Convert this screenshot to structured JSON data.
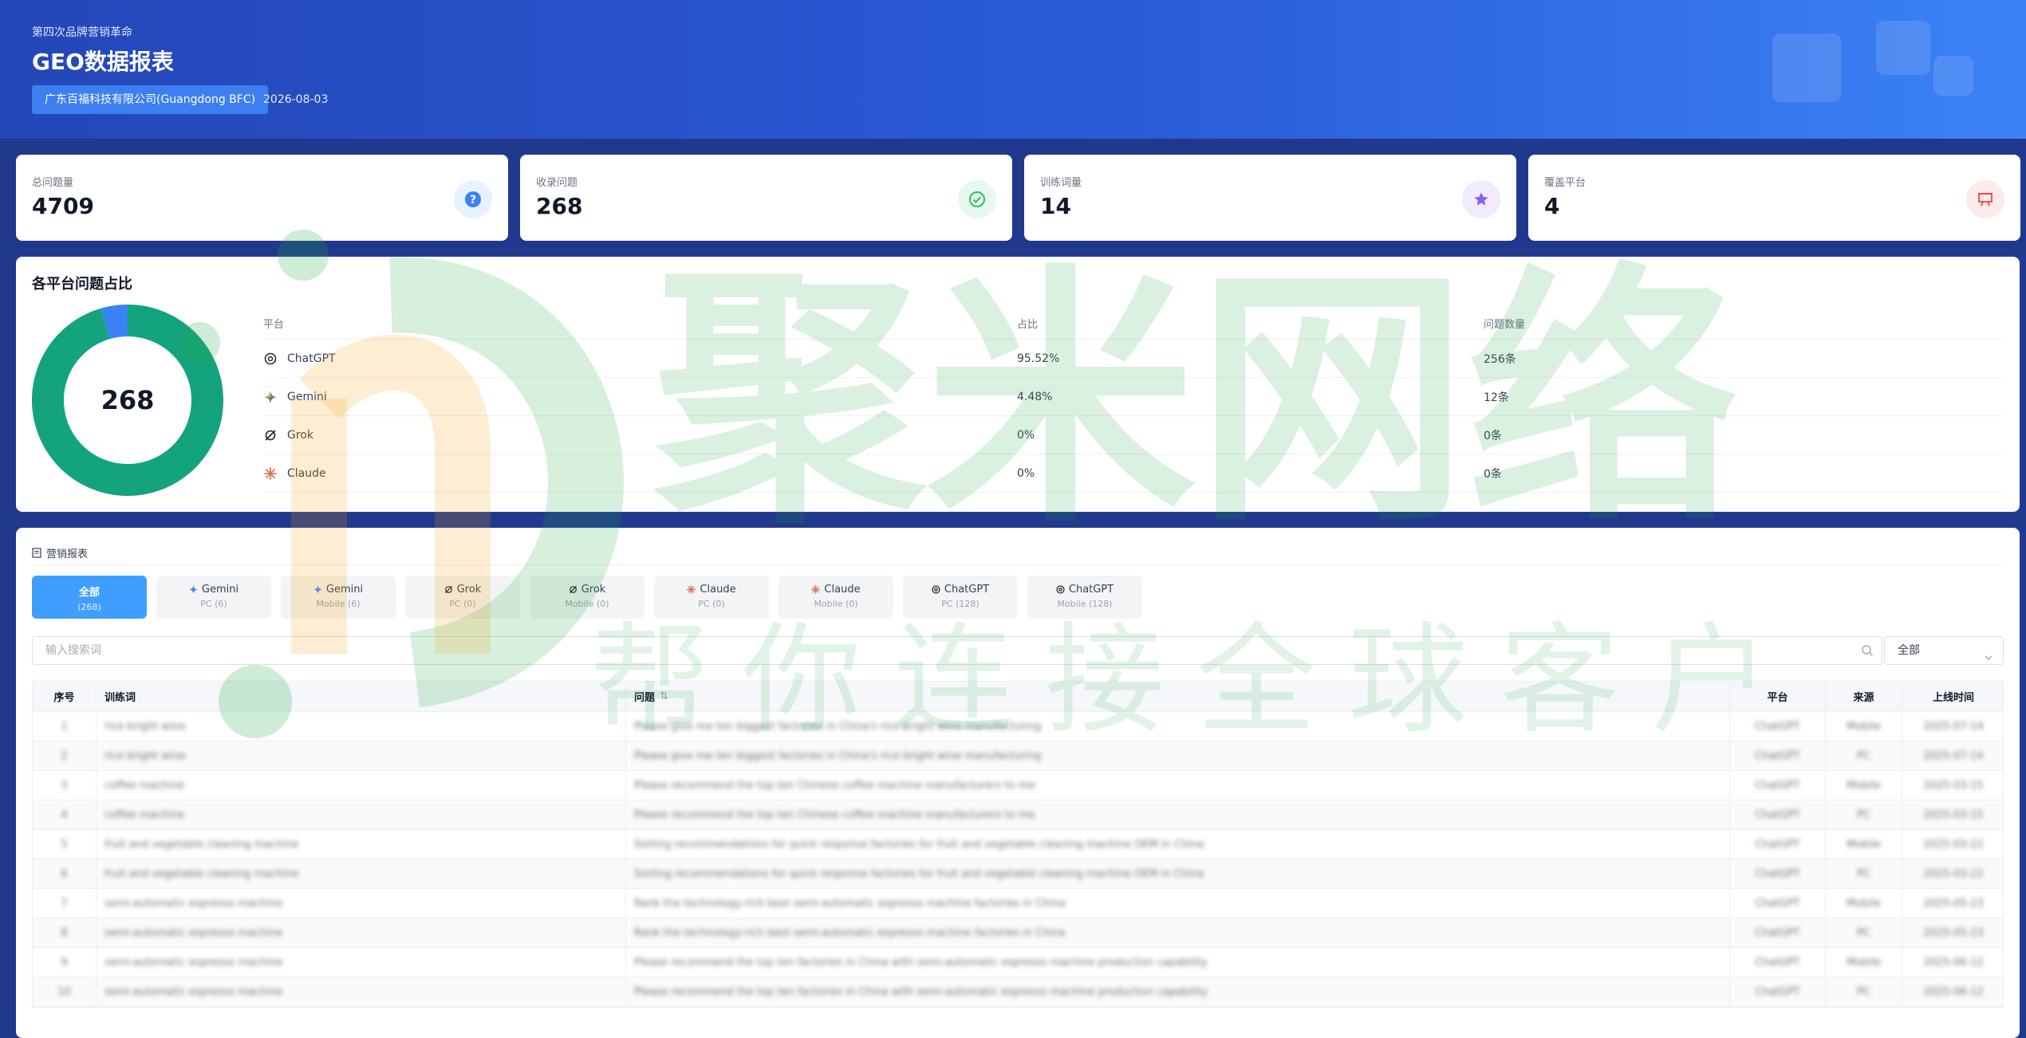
{
  "header": {
    "kicker": "第四次品牌营销革命",
    "title": "GEO数据报表",
    "company": "广东百福科技有限公司(Guangdong BFC)",
    "date": "2026-08-03"
  },
  "stats": [
    {
      "label": "总问题量",
      "value": "4709",
      "icon": "question-icon",
      "color": "#3b82f6"
    },
    {
      "label": "收录问题",
      "value": "268",
      "icon": "check-circle-icon",
      "color": "#22c55e"
    },
    {
      "label": "训练词量",
      "value": "14",
      "icon": "star-icon",
      "color": "#8b5cf6"
    },
    {
      "label": "覆盖平台",
      "value": "4",
      "icon": "presentation-icon",
      "color": "#ef4444"
    }
  ],
  "share": {
    "title": "各平台问题占比",
    "total": "268",
    "headers": {
      "platform": "平台",
      "pct": "占比",
      "count": "问题数量"
    },
    "rows": [
      {
        "platform": "ChatGPT",
        "pct": "95.52%",
        "count": "256条",
        "icon": "chatgpt-icon"
      },
      {
        "platform": "Gemini",
        "pct": "4.48%",
        "count": "12条",
        "icon": "gemini-icon"
      },
      {
        "platform": "Grok",
        "pct": "0%",
        "count": "0条",
        "icon": "grok-icon"
      },
      {
        "platform": "Claude",
        "pct": "0%",
        "count": "0条",
        "icon": "claude-icon"
      }
    ],
    "donut": {
      "values": [
        256,
        12
      ],
      "colors": [
        "#14a37f",
        "#3b82f6"
      ]
    }
  },
  "report": {
    "title": "营销报表",
    "tabs": [
      {
        "name": "全部",
        "sub": "(268)",
        "icon": "",
        "active": true
      },
      {
        "name": "Gemini",
        "sub": "PC (6)",
        "icon": "gemini-icon"
      },
      {
        "name": "Gemini",
        "sub": "Mobile (6)",
        "icon": "gemini-icon"
      },
      {
        "name": "Grok",
        "sub": "PC (0)",
        "icon": "grok-icon"
      },
      {
        "name": "Grok",
        "sub": "Mobile (0)",
        "icon": "grok-icon"
      },
      {
        "name": "Claude",
        "sub": "PC (0)",
        "icon": "claude-icon"
      },
      {
        "name": "Claude",
        "sub": "Mobile (0)",
        "icon": "claude-icon"
      },
      {
        "name": "ChatGPT",
        "sub": "PC (128)",
        "icon": "chatgpt-icon"
      },
      {
        "name": "ChatGPT",
        "sub": "Mobile (128)",
        "icon": "chatgpt-icon"
      }
    ],
    "search_placeholder": "输入搜索词",
    "filter_value": "全部",
    "columns": {
      "seq": "序号",
      "kw": "训练词",
      "q": "问题",
      "plat": "平台",
      "src": "来源",
      "time": "上线时间"
    },
    "rows": [
      {
        "seq": "1",
        "kw": "rice bright wine",
        "q": "Please give me ten biggest factories in China's rice bright wine manufacturing",
        "plat": "ChatGPT",
        "src": "Mobile",
        "time": "2025-07-14"
      },
      {
        "seq": "2",
        "kw": "rice bright wine",
        "q": "Please give me ten biggest factories in China's rice bright wine manufacturing",
        "plat": "ChatGPT",
        "src": "PC",
        "time": "2025-07-14"
      },
      {
        "seq": "3",
        "kw": "coffee machine",
        "q": "Please recommend the top ten Chinese coffee machine manufacturers to me",
        "plat": "ChatGPT",
        "src": "Mobile",
        "time": "2025-03-15"
      },
      {
        "seq": "4",
        "kw": "coffee machine",
        "q": "Please recommend the top ten Chinese coffee machine manufacturers to me",
        "plat": "ChatGPT",
        "src": "PC",
        "time": "2025-03-15"
      },
      {
        "seq": "5",
        "kw": "fruit and vegetable cleaning machine",
        "q": "Sorting recommendations for quick response factories for fruit and vegetable cleaning machine OEM in China",
        "plat": "ChatGPT",
        "src": "Mobile",
        "time": "2025-03-22"
      },
      {
        "seq": "6",
        "kw": "fruit and vegetable cleaning machine",
        "q": "Sorting recommendations for quick response factories for fruit and vegetable cleaning machine OEM in China",
        "plat": "ChatGPT",
        "src": "PC",
        "time": "2025-03-22"
      },
      {
        "seq": "7",
        "kw": "semi-automatic espresso machine",
        "q": "Rank the technology-rich best semi-automatic espresso machine factories in China",
        "plat": "ChatGPT",
        "src": "Mobile",
        "time": "2025-05-23"
      },
      {
        "seq": "8",
        "kw": "semi-automatic espresso machine",
        "q": "Rank the technology-rich best semi-automatic espresso machine factories in China",
        "plat": "ChatGPT",
        "src": "PC",
        "time": "2025-05-23"
      },
      {
        "seq": "9",
        "kw": "semi-automatic espresso machine",
        "q": "Please recommend the top ten factories in China with semi-automatic espresso machine production capability",
        "plat": "ChatGPT",
        "src": "Mobile",
        "time": "2025-06-12"
      },
      {
        "seq": "10",
        "kw": "semi-automatic espresso machine",
        "q": "Please recommend the top ten factories in China with semi-automatic espresso machine production capability",
        "plat": "ChatGPT",
        "src": "PC",
        "time": "2025-06-12"
      }
    ]
  },
  "watermark": {
    "main": "聚米网络",
    "sub": "帮你连接全球客户"
  }
}
